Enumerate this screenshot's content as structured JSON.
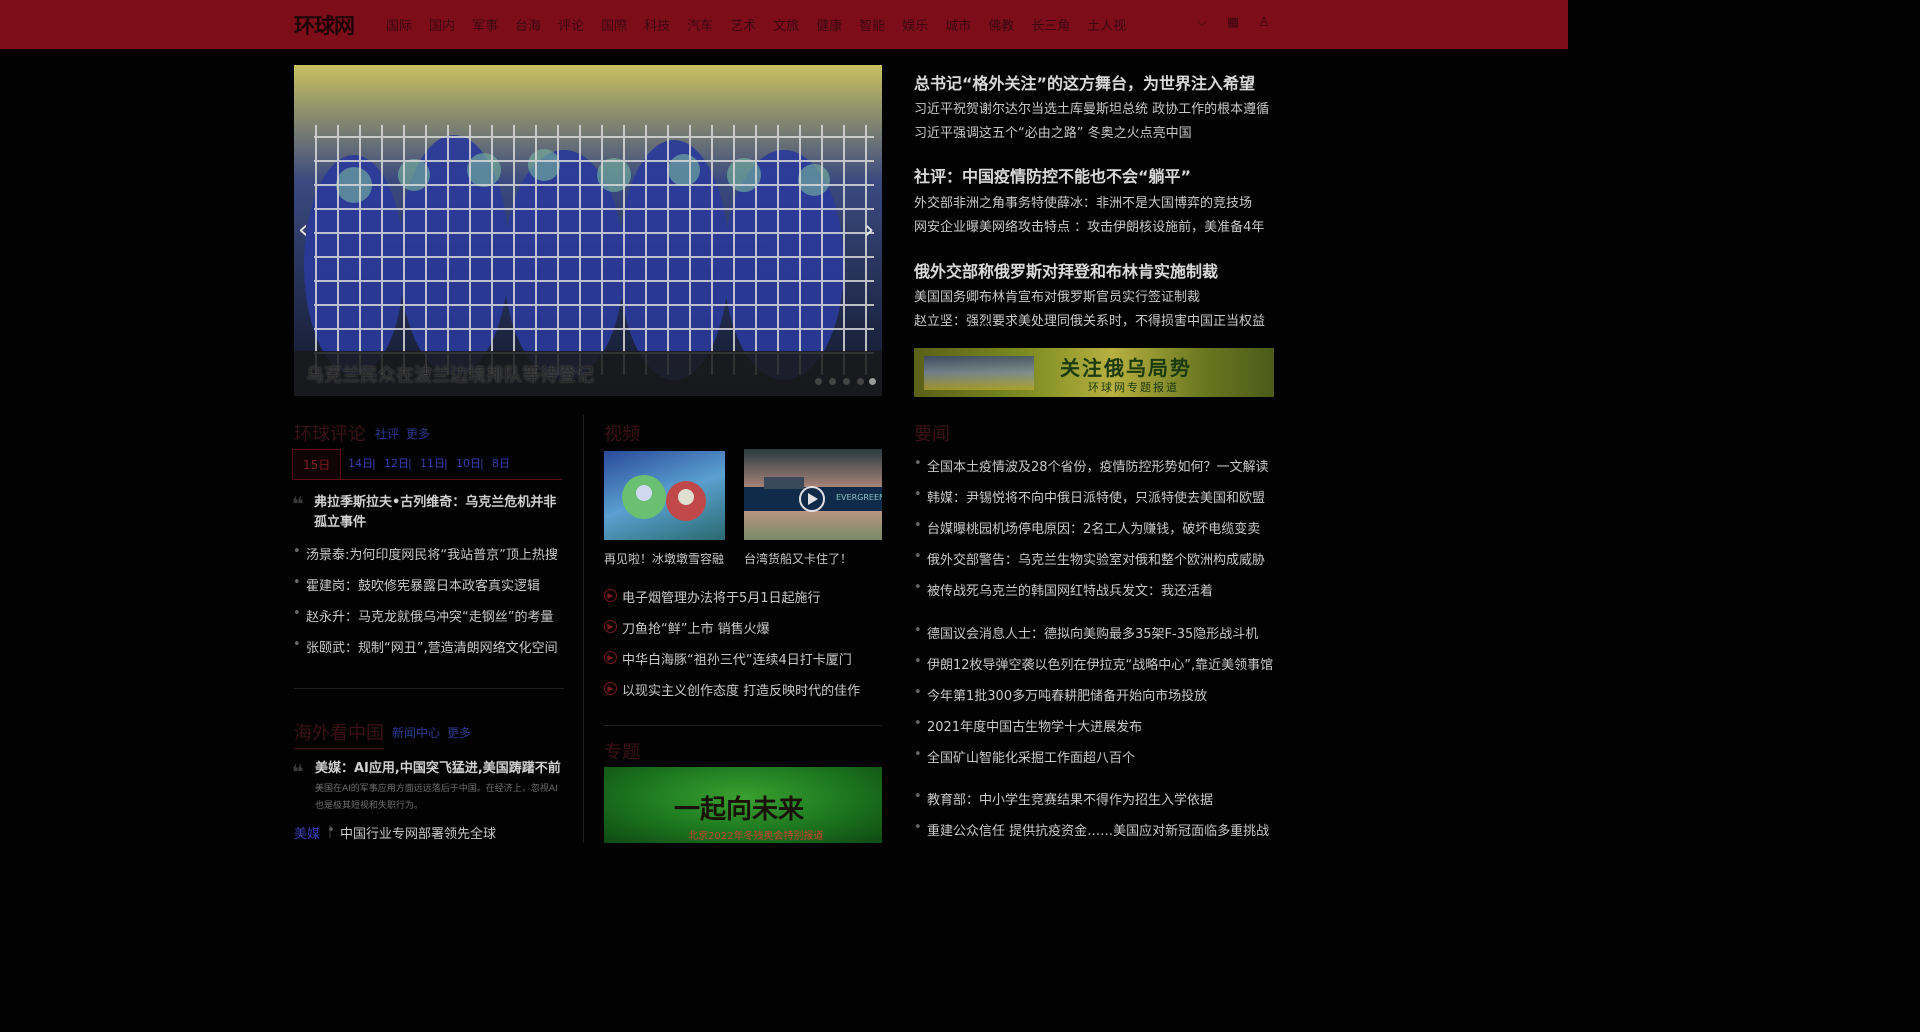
{
  "header": {
    "logo": "环球网",
    "nav": [
      "国际",
      "国内",
      "军事",
      "台海",
      "评论",
      "国際",
      "科技",
      "汽车",
      "艺术",
      "文旅",
      "健康",
      "智能",
      "娱乐",
      "城市",
      "佛教",
      "长三角",
      "土人视"
    ],
    "icons": [
      "chevron-down-icon",
      "apps-icon",
      "user-icon"
    ]
  },
  "slider": {
    "caption": "乌克兰民众在波兰边境排队等待登记"
  },
  "headlines": {
    "groups": [
      {
        "title": "总书记“格外关注”的这方舞台，为世界注入希望",
        "items": [
          "习近平祝贺谢尔达尔当选土库曼斯坦总统 政协工作的根本遵循",
          "习近平强调这五个“必由之路” 冬奥之火点亮中国"
        ]
      },
      {
        "title": "社评：中国疫情防控不能也不会“躺平”",
        "items": [
          "外交部非洲之角事务特使薛冰：非洲不是大国博弈的竞技场",
          "网安企业曝美网络攻击特点 ：攻击伊朗核设施前，美准备4年"
        ]
      },
      {
        "title": "俄外交部称俄罗斯对拜登和布林肯实施制裁",
        "items": [
          "美国国务卿布林肯宣布对俄罗斯官员实行签证制裁",
          "赵立坚：强烈要求美处理同俄关系时，不得损害中国正当权益"
        ]
      }
    ],
    "banner_title": "关注俄乌局势",
    "banner_sub": "环球网专题报道"
  },
  "commentary": {
    "title": "环球评论",
    "links": [
      "社评",
      "更多"
    ],
    "dates": [
      "15日",
      "14日",
      "12日",
      "11日",
      "10日",
      "8日"
    ],
    "featured": "弗拉季斯拉夫•古列维奇：乌克兰危机并非孤立事件",
    "items": [
      "汤景泰:为何印度网民将“我站普京”顶上热搜",
      "霍建岗：鼓吹修宪暴露日本政客真实逻辑",
      "赵永升：马克龙就俄乌冲突“走钢丝”的考量",
      "张颐武：规制“网丑”,营造清朗网络文化空间"
    ]
  },
  "overseas": {
    "title": "海外看中国",
    "links": [
      "新闻中心",
      "更多"
    ],
    "featured": "美媒：AI应用,中国突飞猛进,美国踌躇不前",
    "summary": "美国在AI的军事应用方面远远落后于中国。在经济上，忽视AI也是极其短视和失职行为。",
    "tag": "美媒",
    "tag_item": "中国行业专网部署领先全球"
  },
  "video": {
    "title": "视频",
    "thumbs": [
      "再见啦！冰墩墩雪容融",
      "台湾货船又卡住了！"
    ],
    "items": [
      "电子烟管理办法将于5月1日起施行",
      "刀鱼抢“鲜”上市 销售火爆",
      "中华白海豚“祖孙三代”连续4日打卡厦门",
      "以现实主义创作态度 打造反映时代的佳作"
    ],
    "ship_text": "EVERGREEN"
  },
  "topic": {
    "title": "专题",
    "banner_title": "一起向未来",
    "banner_sub": "北京2022年冬残奥会特别报道"
  },
  "news": {
    "title": "要闻",
    "items": [
      "全国本土疫情波及28个省份，疫情防控形势如何？一文解读",
      "韩媒：尹锡悦将不向中俄日派特使，只派特使去美国和欧盟",
      "台媒曝桃园机场停电原因：2名工人为赚钱，破坏电缆变卖",
      "俄外交部警告：乌克兰生物实验室对俄和整个欧洲构成威胁",
      "被传战死乌克兰的韩国网红特战兵发文：我还活着",
      "德国议会消息人士：德拟向美购最多35架F-35隐形战斗机",
      "伊朗12枚导弹空袭以色列在伊拉克“战略中心”,靠近美领事馆",
      "今年第1批300多万吨春耕肥储备开始向市场投放",
      "2021年度中国古生物学十大进展发布",
      "全国矿山智能化采掘工作面超八百个",
      "教育部：中小学生竞赛结果不得作为招生入学依据",
      "重建公众信任 提供抗疫资金……美国应对新冠面临多重挑战"
    ]
  }
}
